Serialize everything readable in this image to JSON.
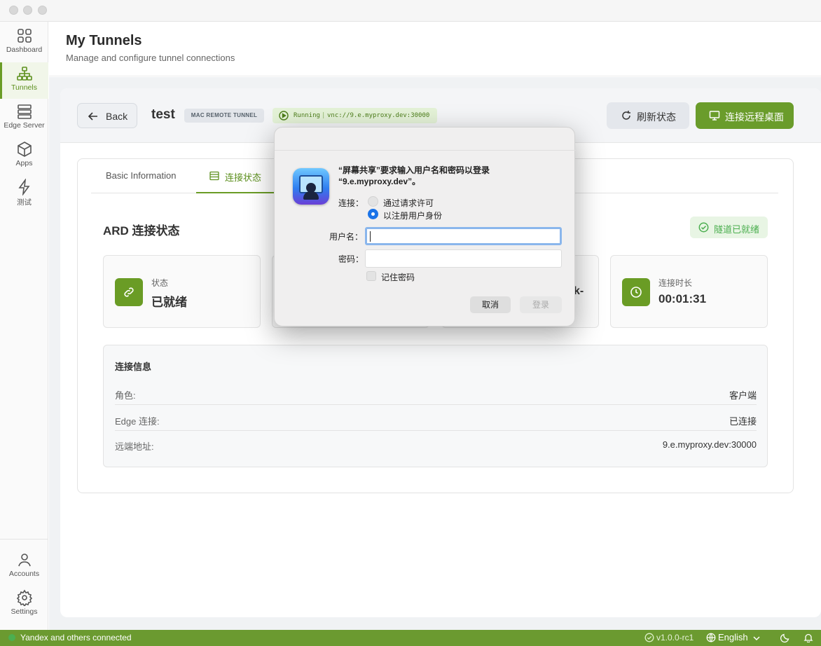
{
  "sidebar": {
    "items": [
      {
        "label": "Dashboard",
        "icon": "grid-icon"
      },
      {
        "label": "Tunnels",
        "icon": "network-icon",
        "active": true
      },
      {
        "label": "Edge Server",
        "icon": "server-icon"
      },
      {
        "label": "Apps",
        "icon": "cube-icon"
      },
      {
        "label": "测试",
        "icon": "bolt-icon"
      }
    ],
    "bottom": [
      {
        "label": "Accounts",
        "icon": "user-icon"
      },
      {
        "label": "Settings",
        "icon": "gear-icon"
      }
    ]
  },
  "header": {
    "title": "My Tunnels",
    "subtitle": "Manage and configure tunnel connections"
  },
  "tunnel": {
    "back_label": "Back",
    "name": "test",
    "type_badge": "MAC REMOTE TUNNEL",
    "running_label": "Running",
    "running_url": "vnc://9.e.myproxy.dev:30000",
    "refresh_label": "刷新状态",
    "connect_label": "连接远程桌面"
  },
  "tabs": {
    "basic": "Basic Information",
    "status": "连接状态"
  },
  "status_section": {
    "title": "ARD 连接状态",
    "ready_badge": "隧道已就绪",
    "cards": [
      {
        "label": "状态",
        "value": "已就绪"
      },
      {
        "label": "连接时长",
        "value": "00:01:31"
      }
    ],
    "partial_text": "k-"
  },
  "info": {
    "title": "连接信息",
    "rows": [
      {
        "key": "角色:",
        "value": "客户端"
      },
      {
        "key": "Edge 连接:",
        "value": "已连接"
      },
      {
        "key": "远端地址:",
        "value": "9.e.myproxy.dev:30000"
      }
    ]
  },
  "dialog": {
    "title_line1": "“屏幕共享”要求输入用户名和密码以登录",
    "title_line2": "“9.e.myproxy.dev”。",
    "connect_label": "连接：",
    "option_request": "通过请求许可",
    "option_registered": "以注册用户身份",
    "selected_option": "以注册用户身份",
    "username_label": "用户名：",
    "username_value": "",
    "password_label": "密码：",
    "password_value": "",
    "remember_label": "记住密码",
    "cancel_label": "取消",
    "login_label": "登录"
  },
  "statusbar": {
    "connection": "Yandex and others connected",
    "version": "v1.0.0-rc1",
    "language": "English"
  },
  "colors": {
    "accent": "#6a9c25",
    "statusbar": "#6b9a30",
    "ready_green": "#4caf50"
  }
}
